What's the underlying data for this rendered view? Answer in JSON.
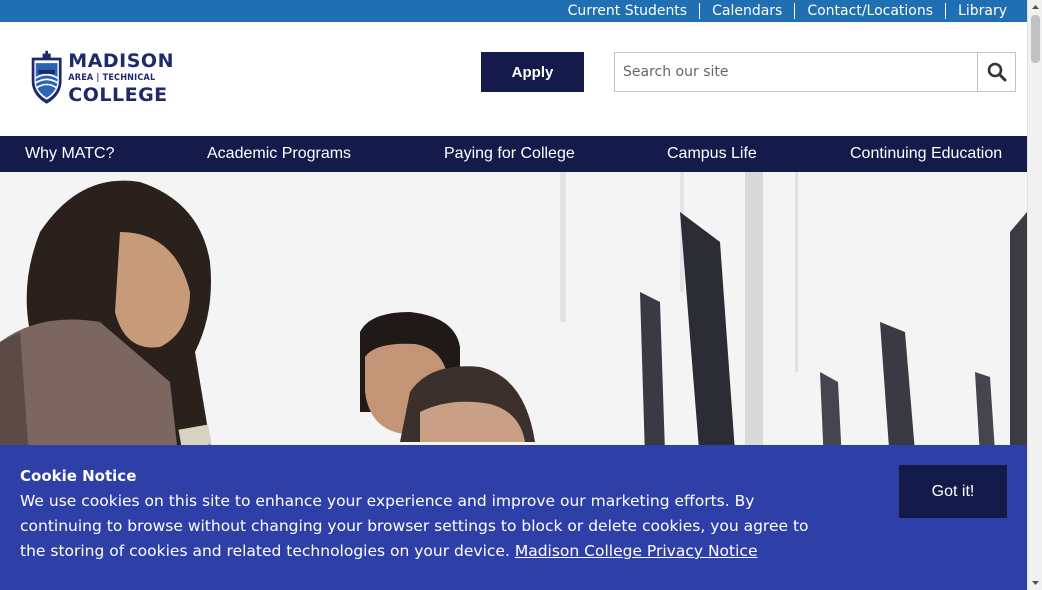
{
  "utility_nav": {
    "links": [
      "Current Students",
      "Calendars",
      "Contact/Locations",
      "Library"
    ]
  },
  "logo": {
    "line1": "MADISON",
    "line2": "AREA | TECHNICAL",
    "line3": "COLLEGE"
  },
  "header": {
    "apply_label": "Apply",
    "search_placeholder": "Search our site",
    "search_value": ""
  },
  "main_nav": {
    "items": [
      "Why MATC?",
      "Academic Programs",
      "Paying for College",
      "Campus Life",
      "Continuing Education"
    ]
  },
  "cookie_notice": {
    "title": "Cookie Notice",
    "body": "We use cookies on this site to enhance your experience and improve our marketing efforts. By continuing to browse without changing your browser settings to block or delete cookies, you agree to the storing of cookies and related technologies on your device.",
    "link_text": "Madison College Privacy Notice",
    "button_label": "Got it!"
  },
  "colors": {
    "utility_bar": "#1f6fb2",
    "navy": "#141a4a",
    "cookie_bg": "#2e3fa8",
    "logo_blue": "#1f2a6b"
  },
  "icons": {
    "search": "search-icon",
    "scroll_up": "scroll-up-arrow-icon",
    "scroll_down": "scroll-down-arrow-icon"
  }
}
